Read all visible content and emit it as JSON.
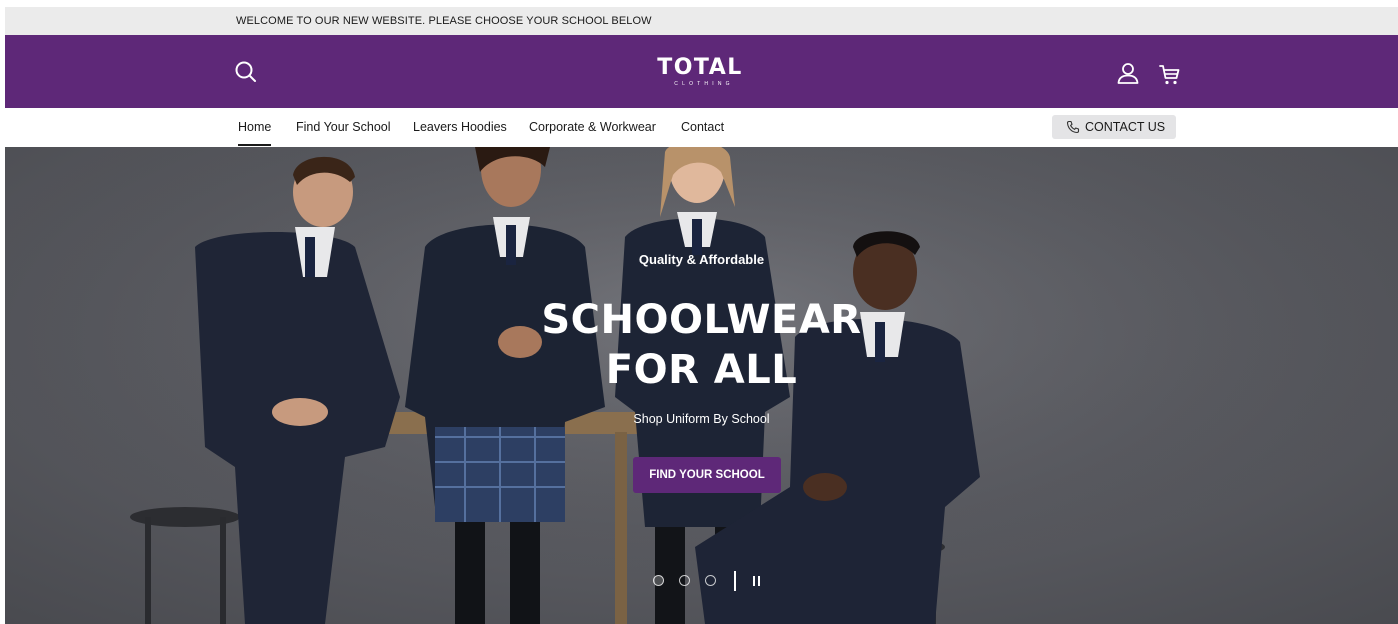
{
  "announcement": {
    "text": "WELCOME TO OUR NEW WEBSITE. PLEASE CHOOSE YOUR SCHOOL BELOW"
  },
  "header": {
    "logo_word": "TOTAL",
    "logo_sub": "CLOTHING",
    "icons": [
      "search-icon",
      "user-icon",
      "cart-icon"
    ],
    "brand_color": "#5e2878"
  },
  "nav": {
    "items": [
      {
        "label": "Home",
        "active": true
      },
      {
        "label": "Find Your School"
      },
      {
        "label": "Leavers Hoodies"
      },
      {
        "label": "Corporate & Workwear"
      },
      {
        "label": "Contact"
      }
    ],
    "contact_button": "CONTACT US"
  },
  "hero": {
    "eyebrow": "Quality & Affordable",
    "headline_line1": "SCHOOLWEAR",
    "headline_line2": "FOR ALL",
    "subline": "Shop Uniform By School",
    "cta": "FIND YOUR SCHOOL",
    "slides_total": 3,
    "active_slide": 1
  }
}
